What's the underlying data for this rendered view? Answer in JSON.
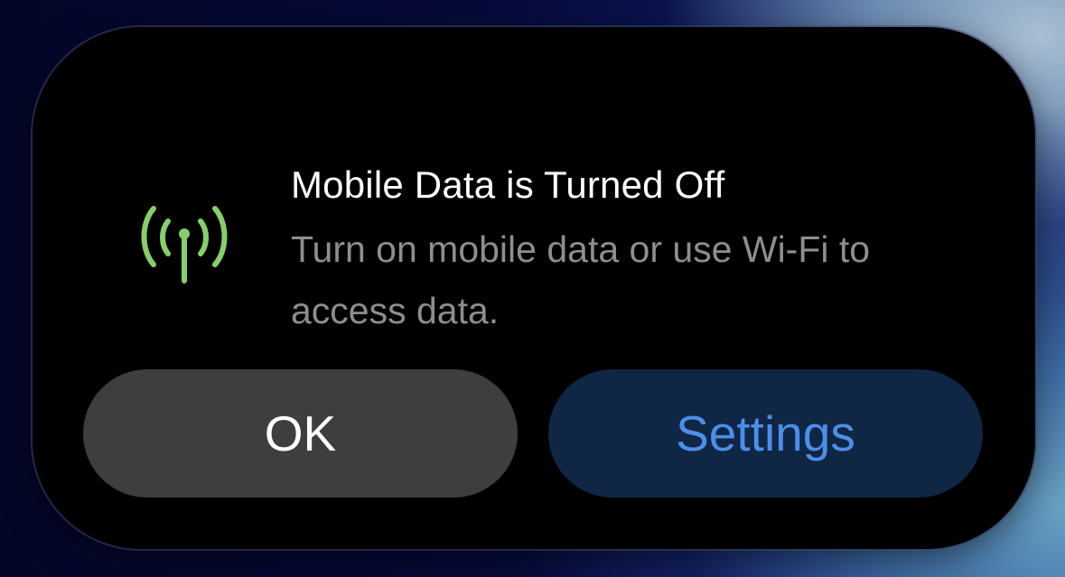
{
  "alert": {
    "icon": "antenna-radiowaves-icon",
    "icon_color": "#86cf6a",
    "title": "Mobile Data is Turned Off",
    "message": "Turn on mobile data or use Wi-Fi to access data.",
    "buttons": {
      "ok_label": "OK",
      "settings_label": "Settings"
    },
    "colors": {
      "settings_text": "#4b8fea",
      "ok_bg": "#3e3e40",
      "settings_bg": "#0f2645"
    }
  }
}
